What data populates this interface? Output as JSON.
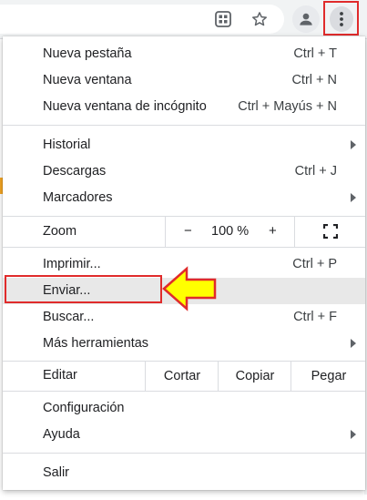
{
  "toolbar": {
    "extension_icon": "grid-extension-icon",
    "bookmark_icon": "star-icon",
    "profile_icon": "person-icon",
    "menu_icon": "three-dots-vertical-icon"
  },
  "menu": {
    "group1": [
      {
        "label": "Nueva pestaña",
        "shortcut": "Ctrl + T"
      },
      {
        "label": "Nueva ventana",
        "shortcut": "Ctrl + N"
      },
      {
        "label": "Nueva ventana de incógnito",
        "shortcut": "Ctrl + Mayús + N"
      }
    ],
    "group2": [
      {
        "label": "Historial",
        "shortcut": ""
      },
      {
        "label": "Descargas",
        "shortcut": "Ctrl + J"
      },
      {
        "label": "Marcadores",
        "shortcut": ""
      }
    ],
    "zoom": {
      "label": "Zoom",
      "minus": "−",
      "value": "100 %",
      "plus": "+"
    },
    "group3": [
      {
        "label": "Imprimir...",
        "shortcut": "Ctrl + P"
      },
      {
        "label": "Enviar...",
        "shortcut": ""
      },
      {
        "label": "Buscar...",
        "shortcut": "Ctrl + F"
      },
      {
        "label": "Más herramientas",
        "shortcut": ""
      }
    ],
    "edit": {
      "label": "Editar",
      "cut": "Cortar",
      "copy": "Copiar",
      "paste": "Pegar"
    },
    "group4": [
      {
        "label": "Configuración",
        "shortcut": ""
      },
      {
        "label": "Ayuda",
        "shortcut": ""
      }
    ],
    "exit": {
      "label": "Salir"
    }
  },
  "colors": {
    "highlight_border": "#e02b2b",
    "arrow_fill": "#ffff00",
    "hover_bg": "#e8e8e8"
  }
}
